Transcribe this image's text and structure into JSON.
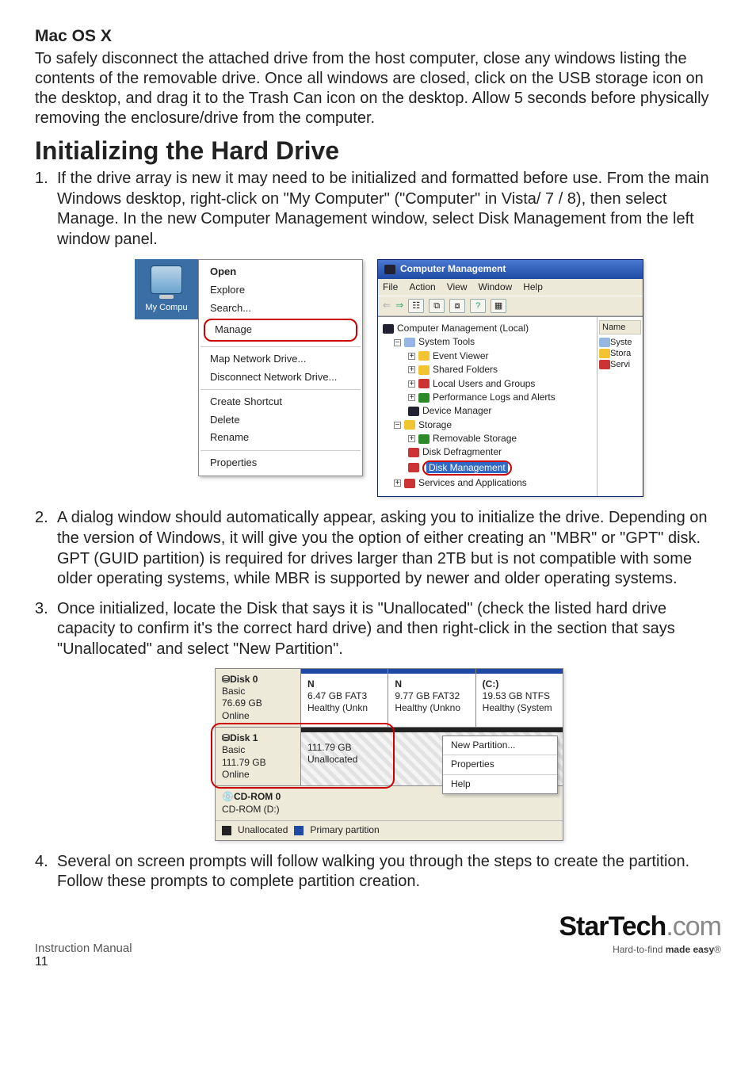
{
  "doc": {
    "subhead": "Mac OS X",
    "intro": "To safely disconnect the attached drive from the host computer, close any windows listing the contents of the removable drive. Once all windows are closed, click on the USB storage icon on the desktop, and drag it to the Trash Can icon on the desktop. Allow 5 seconds before physically removing the enclosure/drive from the computer.",
    "section_title": "Initializing the Hard Drive",
    "steps": [
      {
        "num": "1.",
        "text": "If the drive array is new it may need to be initialized and formatted before use. From the main Windows desktop, right-click on \"My Computer\" (\"Computer\" in Vista/ 7 / 8), then select Manage. In the new Computer Management window, select Disk Management from the left window panel."
      },
      {
        "num": "2.",
        "text": "A dialog window should automatically appear, asking you to initialize the drive. Depending on the version of Windows, it will give you the option of either creating an \"MBR\" or \"GPT\" disk. GPT (GUID partition) is required for drives larger than 2TB but is not compatible with some older operating systems, while MBR is supported by newer and older operating systems."
      },
      {
        "num": "3.",
        "text": "Once initialized, locate the Disk that says it is \"Unallocated\" (check the listed hard drive capacity to confirm it's the correct hard drive) and then right-click in the section that says \"Unallocated\" and select \"New Partition\"."
      },
      {
        "num": "4.",
        "text": "Several on screen prompts will follow walking you through the steps to create the partition.  Follow these prompts to complete partition creation."
      }
    ]
  },
  "ctx": {
    "icon_label": "My Compu",
    "items": [
      "Open",
      "Explore",
      "Search...",
      "Manage",
      "Map Network Drive...",
      "Disconnect Network Drive...",
      "Create Shortcut",
      "Delete",
      "Rename",
      "Properties"
    ],
    "highlighted": "Manage"
  },
  "cm": {
    "title": "Computer Management",
    "menus": [
      "File",
      "Action",
      "View",
      "Window",
      "Help"
    ],
    "tree_root": "Computer Management (Local)",
    "system_tools": "System Tools",
    "st_items": [
      "Event Viewer",
      "Shared Folders",
      "Local Users and Groups",
      "Performance Logs and Alerts",
      "Device Manager"
    ],
    "storage": "Storage",
    "storage_items": [
      "Removable Storage",
      "Disk Defragmenter",
      "Disk Management"
    ],
    "services": "Services and Applications",
    "right_col": {
      "header": "Name",
      "items": [
        "Syste",
        "Stora",
        "Servi"
      ]
    }
  },
  "disk": {
    "disks": [
      {
        "name": "Disk 0",
        "type": "Basic",
        "size": "76.69 GB",
        "status": "Online",
        "parts": [
          {
            "label_top": "N",
            "label_mid": "6.47 GB FAT3",
            "label_bot": "Healthy (Unkn"
          },
          {
            "label_top": "N",
            "label_mid": "9.77 GB FAT32",
            "label_bot": "Healthy (Unkno"
          },
          {
            "label_top": "(C:)",
            "label_mid": "19.53 GB NTFS",
            "label_bot": "Healthy (System"
          }
        ]
      },
      {
        "name": "Disk 1",
        "type": "Basic",
        "size": "111.79 GB",
        "status": "Online",
        "unalloc": {
          "size": "111.79 GB",
          "label": "Unallocated"
        },
        "ctx": [
          "New Partition...",
          "Properties",
          "Help"
        ]
      },
      {
        "name": "CD-ROM 0",
        "sub": "CD-ROM (D:)"
      }
    ],
    "legend": [
      "Unallocated",
      "Primary partition"
    ]
  },
  "footer": {
    "manual": "Instruction Manual",
    "page": "11",
    "brand_main": "StarTech",
    "brand_suffix": ".com",
    "tagline_prefix": "Hard-to-find ",
    "tagline_bold": "made easy",
    "reg": "®"
  }
}
